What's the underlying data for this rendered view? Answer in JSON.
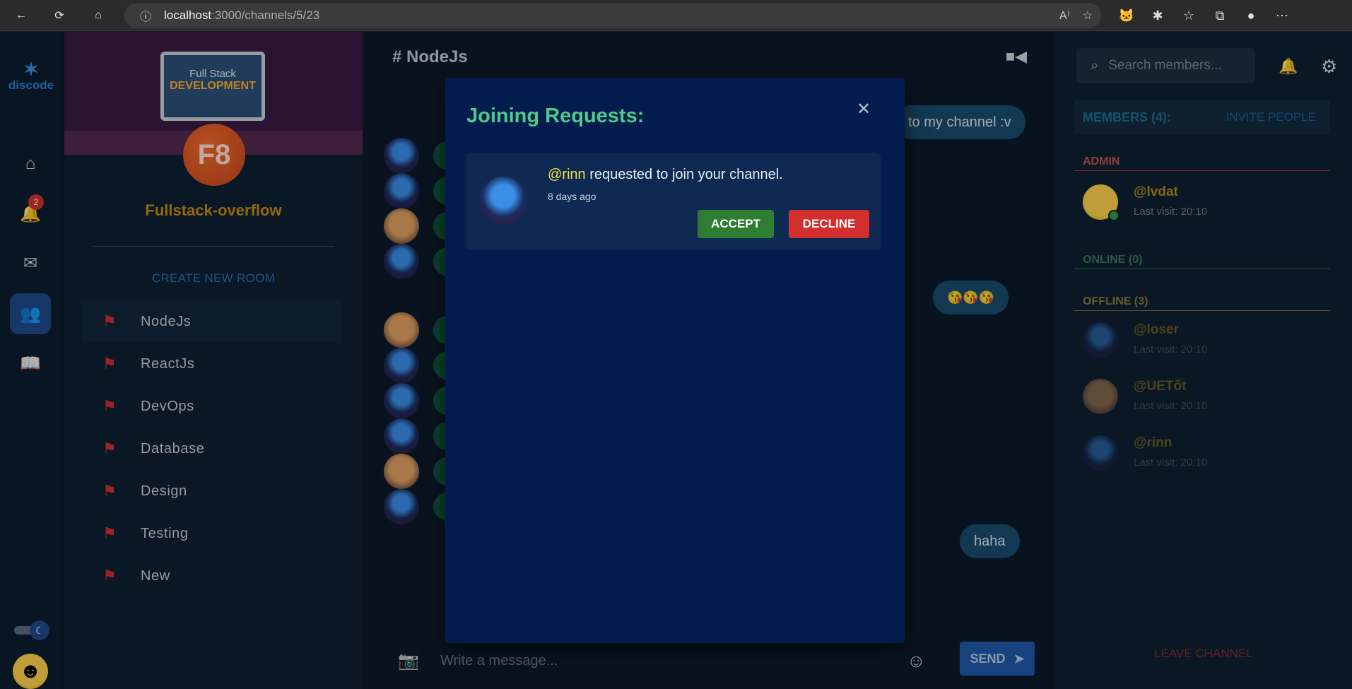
{
  "browser": {
    "url_host": "localhost",
    "url_rest": ":3000/channels/5/23"
  },
  "app": {
    "name": "discode"
  },
  "rail": {
    "notifications_count": "2"
  },
  "channel": {
    "banner_line1": "Full Stack",
    "banner_line2": "DEVELOPMENT",
    "server_initials": "F8",
    "server_name": "Fullstack-overflow",
    "create_room_label": "CREATE NEW ROOM",
    "rooms": [
      {
        "label": "NodeJs",
        "active": true
      },
      {
        "label": "ReactJs",
        "active": false
      },
      {
        "label": "DevOps",
        "active": false
      },
      {
        "label": "Database",
        "active": false
      },
      {
        "label": "Design",
        "active": false
      },
      {
        "label": "Testing",
        "active": false
      },
      {
        "label": "New",
        "active": false
      }
    ]
  },
  "chat": {
    "title": "# NodeJs",
    "bubble_top": "to my channel :v",
    "bubble_emoji": "😘😘😘",
    "bubble_haha": "haha",
    "composer_placeholder": "Write a message...",
    "send_label": "SEND"
  },
  "members": {
    "search_placeholder": "Search members...",
    "header": "MEMBERS (4):",
    "invite_label": "INVITE PEOPLE",
    "admin_label": "ADMIN",
    "online_label": "ONLINE (0)",
    "offline_label": "OFFLINE (3)",
    "admin": {
      "name": "@lvdat",
      "last_visit": "Last visit: 20:10"
    },
    "offline": [
      {
        "name": "@loser",
        "last_visit": "Last visit: 20:10"
      },
      {
        "name": "@UETốt",
        "last_visit": "Last visit: 20:10"
      },
      {
        "name": "@rinn",
        "last_visit": "Last visit: 20:10"
      }
    ],
    "leave_label": "LEAVE CHANNEL"
  },
  "modal": {
    "title": "Joining Requests:",
    "request": {
      "user": "@rinn",
      "text": " requested to join your channel.",
      "time_ago": "8 days ago",
      "accept_label": "ACCEPT",
      "decline_label": "DECLINE"
    }
  },
  "colors": {
    "accent_green": "#4ecb88",
    "accept": "#2e7d32",
    "decline": "#d32f2f",
    "modal_bg": "#021d4d"
  }
}
